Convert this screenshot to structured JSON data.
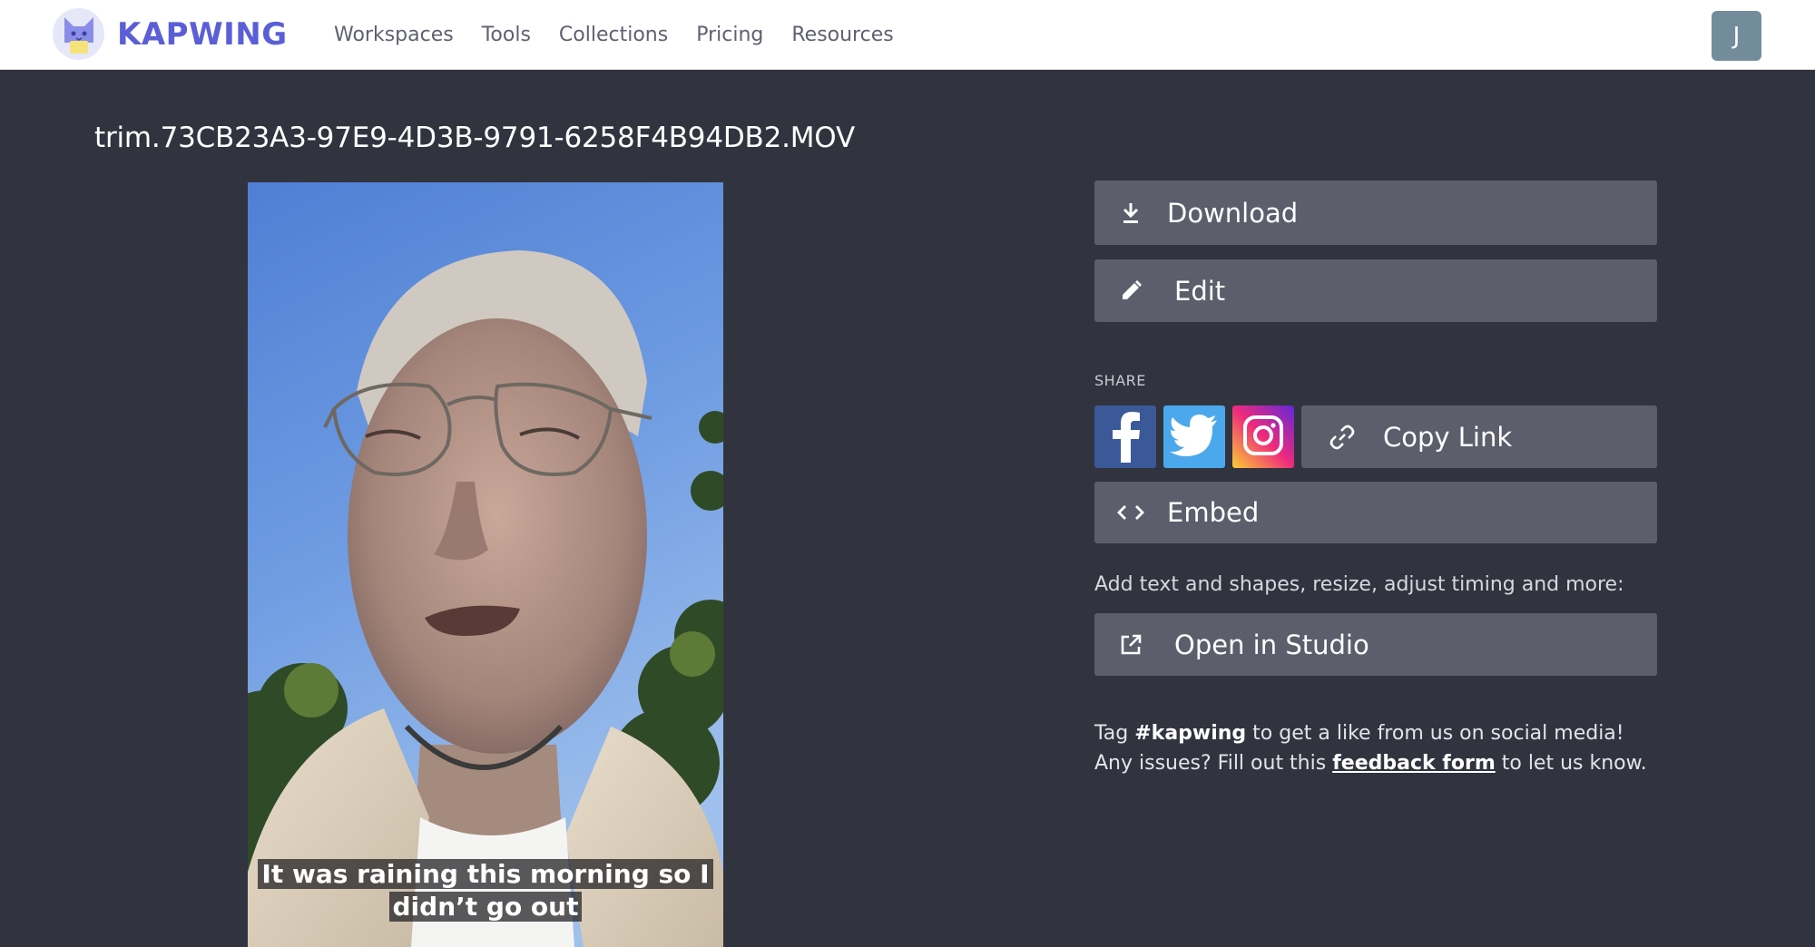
{
  "nav": {
    "brand": "KAPWING",
    "links": [
      "Workspaces",
      "Tools",
      "Collections",
      "Pricing",
      "Resources"
    ],
    "avatar_initial": "J"
  },
  "file": {
    "title": "trim.73CB23A3-97E9-4D3B-9791-6258F4B94DB2.MOV"
  },
  "video": {
    "caption_line1": "It was raining this morning so I",
    "caption_line2": "didn’t go out"
  },
  "actions": {
    "download": "Download",
    "edit": "Edit",
    "share_label": "SHARE",
    "copy_link": "Copy Link",
    "embed": "Embed",
    "studio_hint": "Add text and shapes, resize, adjust timing and more:",
    "open_studio": "Open in Studio"
  },
  "tagline": {
    "t1": "Tag ",
    "hashtag": "#kapwing",
    "t2": " to get a like from us on social media! Any issues? Fill out this ",
    "link": "feedback form",
    "t3": " to let us know."
  },
  "colors": {
    "brand": "#5b5fd6",
    "background": "#31343f",
    "button": "#5d5e6c",
    "facebook": "#3b5998",
    "twitter": "#4ca8ec"
  }
}
